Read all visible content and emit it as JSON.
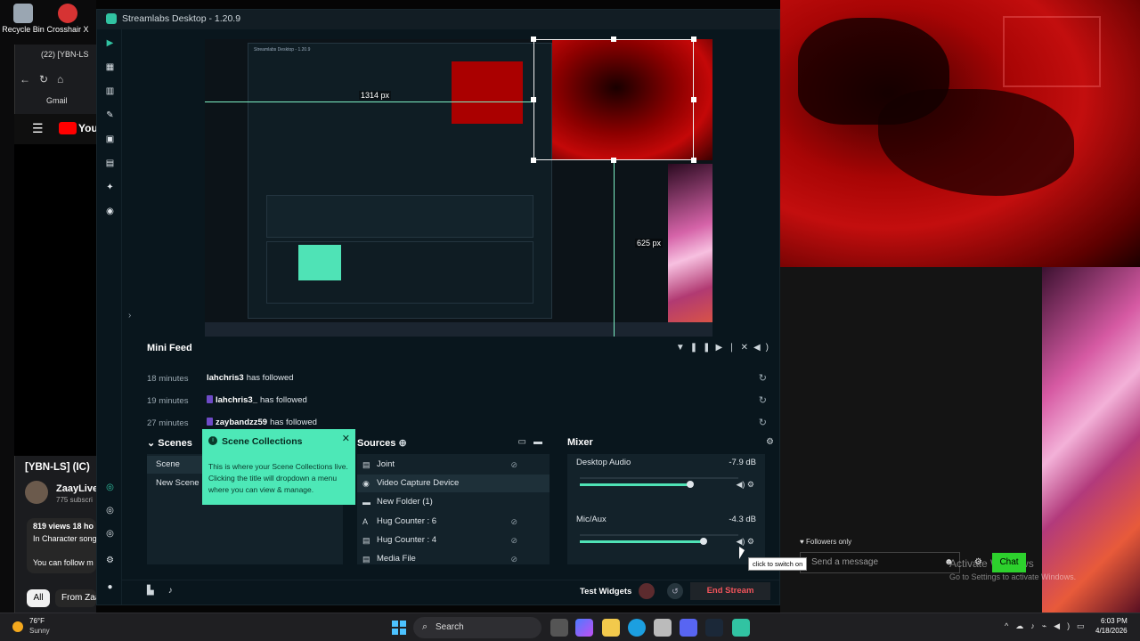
{
  "desktop": {
    "icons": [
      {
        "label": "Recycle Bin",
        "icon": "recycle-bin-icon"
      },
      {
        "label": "Crosshair X",
        "icon": "crosshair-icon"
      }
    ]
  },
  "browser": {
    "tab_title": "(22) [YBN-LS",
    "bookmark": "Gmail",
    "video_title": "[YBN-LS] (IC)",
    "channel": "ZaayLive",
    "subscribers": "775 subscri",
    "views": "819 views  18 ho",
    "song": "In Character song",
    "follow_text": "You can follow m",
    "chips": [
      "All",
      "From Zaa"
    ]
  },
  "app": {
    "title": "Streamlabs Desktop - 1.20.9"
  },
  "preview": {
    "width_label": "1314 px",
    "height_label": "625 px"
  },
  "mini_feed": {
    "title": "Mini Feed",
    "events": [
      {
        "time": "18 minutes",
        "user": "lahchris3",
        "action": "has followed",
        "badge": false
      },
      {
        "time": "19 minutes",
        "user": "lahchris3_",
        "action": "has followed",
        "badge": true
      },
      {
        "time": "27 minutes",
        "user": "zaybandzz59",
        "action": "has followed",
        "badge": true
      }
    ]
  },
  "scenes": {
    "title": "Scenes",
    "items": [
      "Scene",
      "New Scene"
    ]
  },
  "tooltip": {
    "title": "Scene Collections",
    "body": "This is where your Scene Collections live. Clicking the title will dropdown a menu where you can view & manage."
  },
  "sources": {
    "title": "Sources",
    "items": [
      {
        "label": "Joint",
        "icon": "document-icon",
        "glyph": "▤"
      },
      {
        "label": "Video Capture Device",
        "icon": "camera-icon",
        "glyph": "◉"
      },
      {
        "label": "New Folder (1)",
        "icon": "folder-icon",
        "glyph": "▬"
      },
      {
        "label": "Hug Counter : 6",
        "icon": "text-icon",
        "glyph": "A"
      },
      {
        "label": "Hug Counter : 4",
        "icon": "document-icon",
        "glyph": "▤"
      },
      {
        "label": "Media File",
        "icon": "document-icon",
        "glyph": "▤"
      }
    ]
  },
  "mixer": {
    "title": "Mixer",
    "channels": [
      {
        "name": "Desktop Audio",
        "db": "-7.9 dB",
        "level": 0.84
      },
      {
        "name": "Mic/Aux",
        "db": "-4.3 dB",
        "level": 0.94
      }
    ]
  },
  "bottom_bar": {
    "test_widgets": "Test Widgets",
    "end_stream": "End Stream"
  },
  "switch_tooltip": "click to switch on",
  "chat": {
    "followers_only": "Followers only",
    "placeholder": "Send a message",
    "chat_button": "Chat"
  },
  "watermark": {
    "line1": "Activate Windows",
    "line2": "Go to Settings to activate Windows."
  },
  "taskbar": {
    "temperature": "76°F",
    "condition": "Sunny",
    "search": "Search",
    "time": "6:03 PM",
    "date": "4/18/2026"
  },
  "colors": {
    "accent": "#31c3a2",
    "tooltip_bg": "#4de8b7",
    "end_stream": "#f2545b",
    "chat_button": "#2dd12d"
  }
}
